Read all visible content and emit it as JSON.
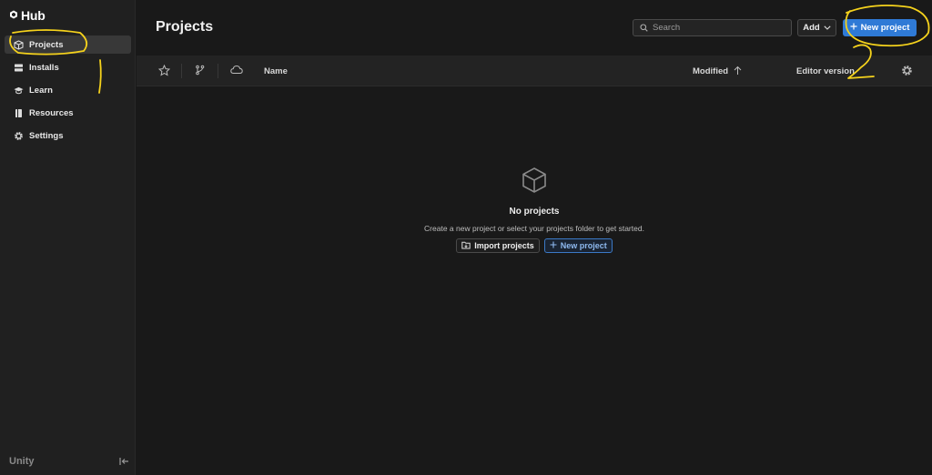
{
  "app": {
    "name": "Hub",
    "footer_logo": "Unity"
  },
  "sidebar": {
    "items": [
      {
        "label": "Projects",
        "icon": "cube-icon",
        "active": true
      },
      {
        "label": "Installs",
        "icon": "server-icon",
        "active": false
      },
      {
        "label": "Learn",
        "icon": "graduation-cap-icon",
        "active": false
      },
      {
        "label": "Resources",
        "icon": "book-icon",
        "active": false
      },
      {
        "label": "Settings",
        "icon": "gear-icon",
        "active": false
      }
    ]
  },
  "header": {
    "title": "Projects",
    "search_placeholder": "Search",
    "add_label": "Add",
    "new_project_label": "New project"
  },
  "table": {
    "columns": {
      "name": "Name",
      "modified": "Modified",
      "editor_version": "Editor version"
    },
    "icons": [
      "star-icon",
      "branch-icon",
      "cloud-icon",
      "sort-arrow-up-icon",
      "gear-icon"
    ]
  },
  "empty_state": {
    "title": "No projects",
    "description": "Create a new project or select your projects folder to get started.",
    "import_label": "Import projects",
    "new_label": "New project"
  },
  "annotations": {
    "step_number": "2"
  },
  "colors": {
    "accent": "#2f7ad6",
    "highlight": "#f5d21c",
    "background": "#191919",
    "sidebar": "#202020"
  }
}
